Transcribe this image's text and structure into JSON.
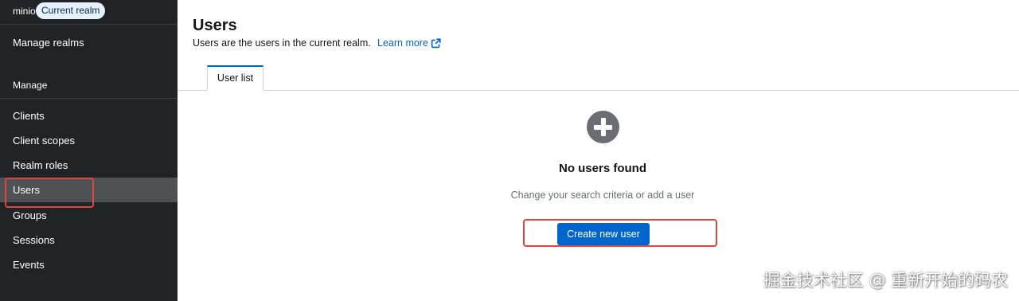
{
  "sidebar": {
    "realm_name": "minio",
    "realm_badge": "Current realm",
    "manage_realms": "Manage realms",
    "section_title": "Manage",
    "items": [
      {
        "label": "Clients",
        "active": false
      },
      {
        "label": "Client scopes",
        "active": false
      },
      {
        "label": "Realm roles",
        "active": false
      },
      {
        "label": "Users",
        "active": true
      },
      {
        "label": "Groups",
        "active": false
      },
      {
        "label": "Sessions",
        "active": false
      },
      {
        "label": "Events",
        "active": false
      }
    ]
  },
  "header": {
    "title": "Users",
    "description": "Users are the users in the current realm.",
    "learn_more": "Learn more",
    "learn_more_icon": "external-link-icon"
  },
  "tabs": [
    {
      "label": "User list",
      "active": true
    }
  ],
  "empty_state": {
    "icon": "plus-circle-icon",
    "title": "No users found",
    "body": "Change your search criteria or add a user",
    "button_label": "Create new user"
  },
  "watermark": "掘金技术社区 @ 重新开始的码农",
  "colors": {
    "sidebar_bg": "#212427",
    "active_item_bg": "#4f5255",
    "primary": "#0066cc",
    "annotation": "#e0453f"
  }
}
